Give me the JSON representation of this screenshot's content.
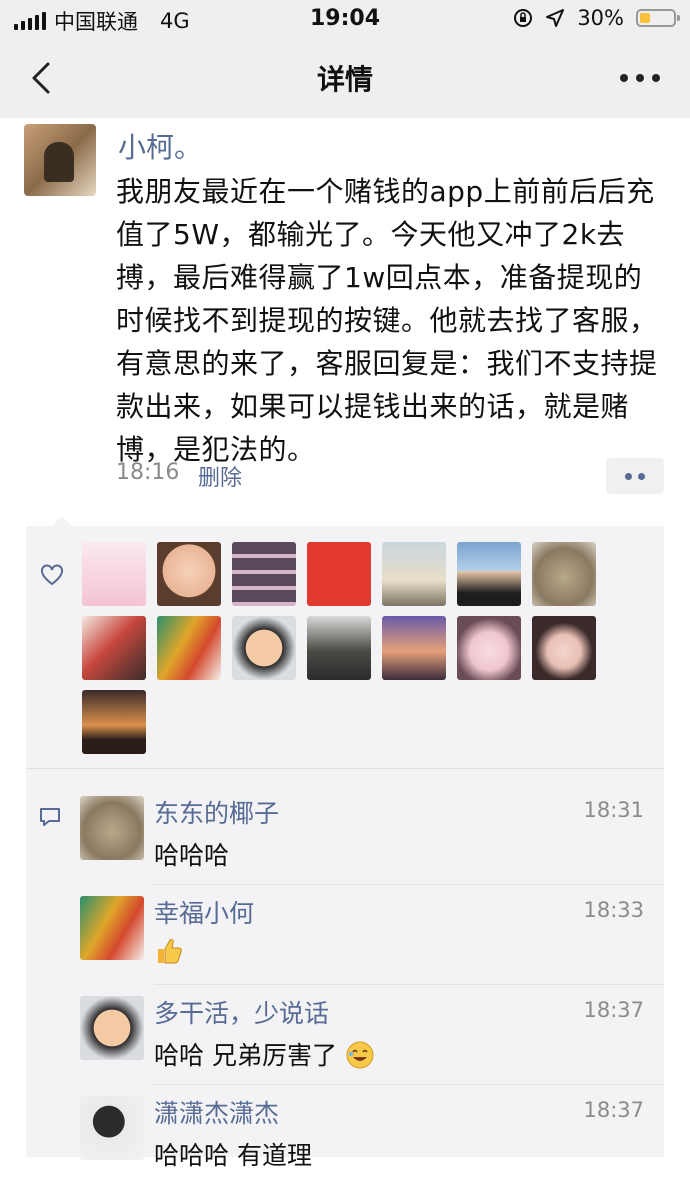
{
  "status_bar": {
    "carrier": "中国联通",
    "network": "4G",
    "time": "19:04",
    "battery": "30%"
  },
  "nav": {
    "title": "详情",
    "back_icon": "chevron-left-icon",
    "more_icon": "more-dots-icon"
  },
  "post": {
    "author": "小柯。",
    "text": "我朋友最近在一个赌钱的app上前前后后充值了5W，都输光了。今天他又冲了2k去搏，最后难得赢了1w回点本，准备提现的时候找不到提现的按键。他就去找了客服，有意思的来了，客服回复是：我们不支持提款出来，如果可以提钱出来的话，就是赌博，是犯法的。",
    "time": "18:16",
    "delete_label": "删除"
  },
  "likes": {
    "icon": "heart-outline-icon",
    "avatar_count": 15
  },
  "comments": [
    {
      "name": "东东的椰子",
      "time": "18:31",
      "text": "哈哈哈"
    },
    {
      "name": "幸福小何",
      "time": "18:33",
      "text": "",
      "emoji": "thumbs-up-emoji"
    },
    {
      "name": "多干活，少说话",
      "time": "18:37",
      "text": "哈哈  兄弟厉害了",
      "emoji": "laughing-emoji"
    },
    {
      "name": "潇潇杰潇杰",
      "time": "18:37",
      "text": "哈哈哈  有道理"
    }
  ],
  "colors": {
    "link": "#576b95",
    "panel": "#f3f3f5",
    "bar": "#efefef"
  }
}
